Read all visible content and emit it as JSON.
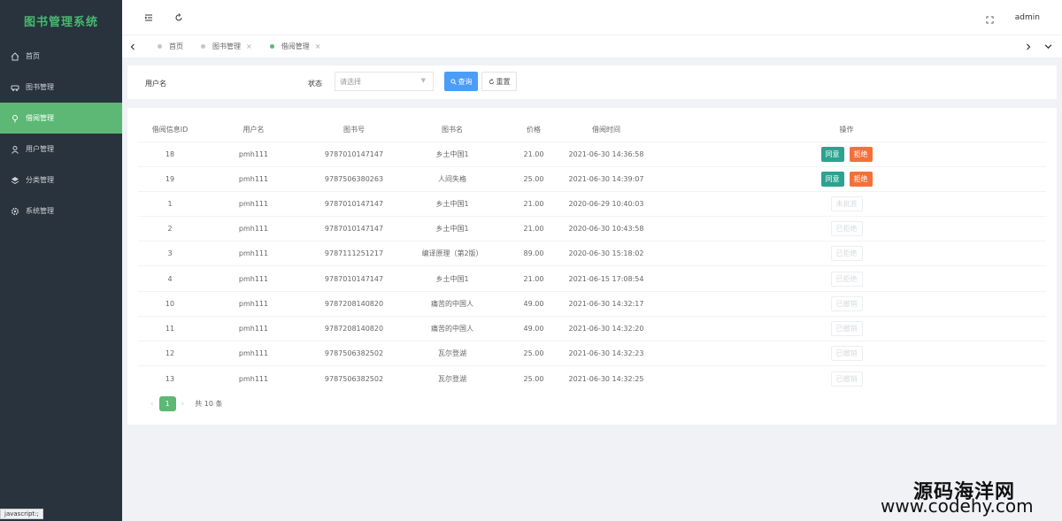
{
  "app_title": "图书管理系统",
  "sidebar": {
    "items": [
      {
        "label": "首页",
        "icon": "home-icon"
      },
      {
        "label": "图书管理",
        "icon": "car-icon"
      },
      {
        "label": "借阅管理",
        "icon": "location-icon",
        "active": true
      },
      {
        "label": "用户管理",
        "icon": "user-icon"
      },
      {
        "label": "分类管理",
        "icon": "layers-icon"
      },
      {
        "label": "系统管理",
        "icon": "gear-icon"
      }
    ]
  },
  "header": {
    "user": "admin"
  },
  "tabs": [
    {
      "label": "首页"
    },
    {
      "label": "图书管理"
    },
    {
      "label": "借阅管理"
    }
  ],
  "search": {
    "username_label": "用户名",
    "status_label": "状态",
    "status_placeholder": "请选择",
    "search_button": "查询",
    "reset_button": "重置"
  },
  "table": {
    "headers": [
      "借阅信息ID",
      "用户名",
      "图书号",
      "图书名",
      "价格",
      "借阅时间",
      "操作"
    ],
    "rows": [
      {
        "id": "18",
        "user": "pmh111",
        "isbn": "9787010147147",
        "name": "乡土中国1",
        "price": "21.00",
        "time": "2021-06-30 14:36:58",
        "ops": [
          "同意",
          "拒绝"
        ]
      },
      {
        "id": "19",
        "user": "pmh111",
        "isbn": "9787506380263",
        "name": "人间失格",
        "price": "25.00",
        "time": "2021-06-30 14:39:07",
        "ops": [
          "同意",
          "拒绝"
        ]
      },
      {
        "id": "1",
        "user": "pmh111",
        "isbn": "9787010147147",
        "name": "乡土中国1",
        "price": "21.00",
        "time": "2020-06-29 10:40:03",
        "ops_disabled": "未批准"
      },
      {
        "id": "2",
        "user": "pmh111",
        "isbn": "9787010147147",
        "name": "乡土中国1",
        "price": "21.00",
        "time": "2020-06-30 10:43:58",
        "ops_disabled": "已拒绝"
      },
      {
        "id": "3",
        "user": "pmh111",
        "isbn": "9787111251217",
        "name": "编译原理（第2版）",
        "price": "89.00",
        "time": "2020-06-30 15:18:02",
        "ops_disabled": "已拒绝"
      },
      {
        "id": "4",
        "user": "pmh111",
        "isbn": "9787010147147",
        "name": "乡土中国1",
        "price": "21.00",
        "time": "2021-06-15 17:08:54",
        "ops_disabled": "已拒绝"
      },
      {
        "id": "10",
        "user": "pmh111",
        "isbn": "9787208140820",
        "name": "痛苦的中国人",
        "price": "49.00",
        "time": "2021-06-30 14:32:17",
        "ops_disabled": "已撤销"
      },
      {
        "id": "11",
        "user": "pmh111",
        "isbn": "9787208140820",
        "name": "痛苦的中国人",
        "price": "49.00",
        "time": "2021-06-30 14:32:20",
        "ops_disabled": "已撤销"
      },
      {
        "id": "12",
        "user": "pmh111",
        "isbn": "9787506382502",
        "name": "瓦尔登湖",
        "price": "25.00",
        "time": "2021-06-30 14:32:23",
        "ops_disabled": "已撤销"
      },
      {
        "id": "13",
        "user": "pmh111",
        "isbn": "9787506382502",
        "name": "瓦尔登湖",
        "price": "25.00",
        "time": "2021-06-30 14:32:25",
        "ops_disabled": "已撤销"
      }
    ]
  },
  "pagination": {
    "current": "1",
    "total_text": "共 10 条"
  },
  "status_bar_url": "javascript:;",
  "watermark": {
    "cn": "源码海洋网",
    "en": "www.codehy.com"
  },
  "colors": {
    "sidebar_bg": "#28333e",
    "accent_green": "#5cb874",
    "teal": "#2aa390",
    "orange": "#f4703a",
    "blue": "#4b9df8"
  }
}
